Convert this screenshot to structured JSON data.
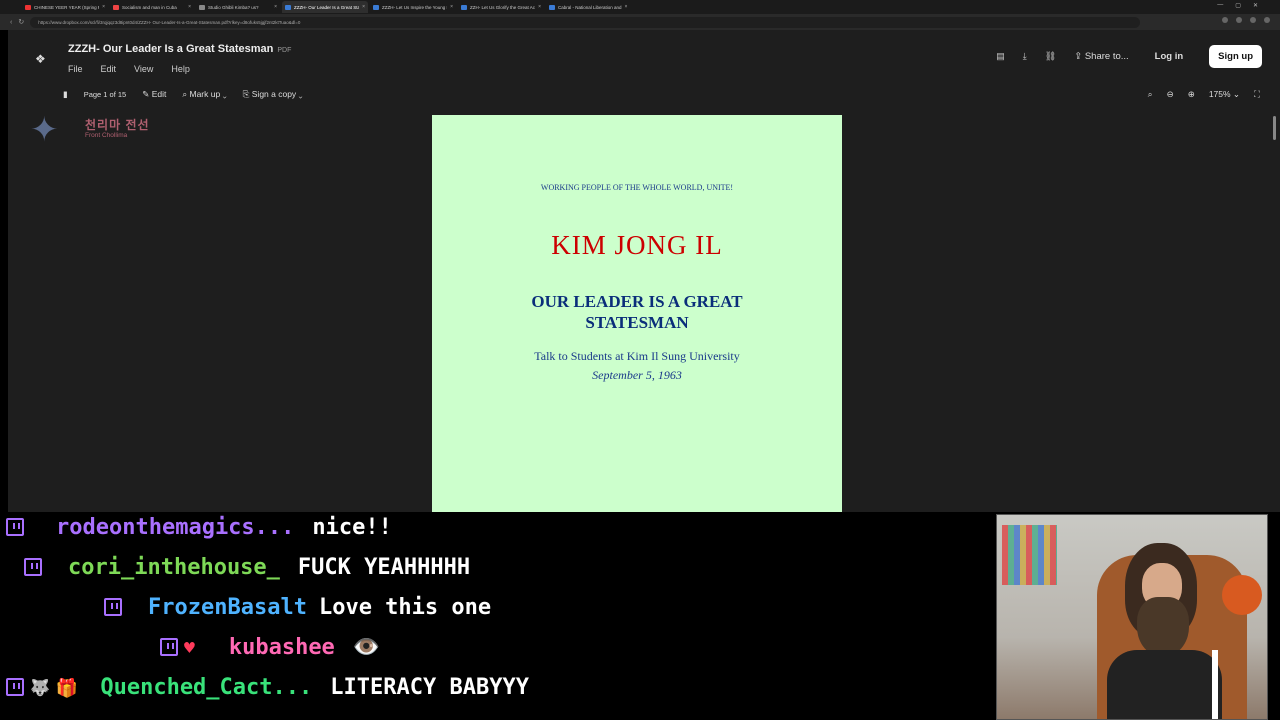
{
  "browser": {
    "tabs": [
      {
        "label": "CHINESE YEER YEAR (Spring Fest",
        "color": "#e33",
        "active": false
      },
      {
        "label": "Socialism and man in Cuba",
        "color": "#e44",
        "active": false
      },
      {
        "label": "Studio Ghibli Kimba? us?",
        "color": "#888",
        "active": false
      },
      {
        "label": "ZZZH- Our Leader Is a Great Statesman",
        "color": "#3a7bd5",
        "active": true
      },
      {
        "label": "ZZZH- Let Us Inspire the Young Pe",
        "color": "#3a7bd5",
        "active": false
      },
      {
        "label": "ZZH- Let Us Glorify the Great Ach",
        "color": "#3a7bd5",
        "active": false
      },
      {
        "label": "Cabral - National Liberation and",
        "color": "#3a7bd5",
        "active": false
      }
    ],
    "url": "https://www.dropbox.com/scl/fi/3rqjqqz3d8ipnt0d4/ZZZH- Our-Leader-Is-a-Great-Statesman.pdf?rlkey=d8ofuks5jgjf2nt2ktTuao&dl=0"
  },
  "viewer": {
    "doc_title": "ZZZH- Our Leader Is a Great Statesman",
    "doc_ext": "PDF",
    "menu": [
      "File",
      "Edit",
      "View",
      "Help"
    ],
    "share_label": "Share to...",
    "login_label": "Log in",
    "signup_label": "Sign up",
    "page_indicator": "Page 1 of 15",
    "edit_label": "Edit",
    "markup_label": "Mark up",
    "sign_label": "Sign a copy",
    "zoom_level": "175%",
    "badge_korean": "천리마 전선",
    "badge_sub": "Front Chollima"
  },
  "pdf": {
    "slogan": "WORKING PEOPLE OF THE WHOLE WORLD, UNITE!",
    "author": "KIM JONG IL",
    "title": "OUR LEADER IS A GREAT STATESMAN",
    "subtitle": "Talk to Students at Kim Il Sung University",
    "date": "September 5, 1963"
  },
  "chat": {
    "messages": [
      {
        "user": "rodeonthemagics...",
        "text": "nice!!",
        "color": "#a970ff",
        "badges": [
          "twitch"
        ]
      },
      {
        "user": "cori_inthehouse_",
        "text": "FUCK YEAHHHHH",
        "color": "#7ed957",
        "badges": [
          "twitch"
        ]
      },
      {
        "user": "FrozenBasalt",
        "text": "Love this one",
        "color": "#4fb3ff",
        "badges": [
          "twitch"
        ]
      },
      {
        "user": "kubashee",
        "text": "👁️",
        "color": "#ff69b4",
        "badges": [
          "twitch",
          "heart"
        ]
      },
      {
        "user": "Quenched_Cact...",
        "text": "LITERACY BABYYY",
        "color": "#39e27a",
        "badges": [
          "twitch",
          "wolf",
          "gift"
        ]
      }
    ]
  }
}
